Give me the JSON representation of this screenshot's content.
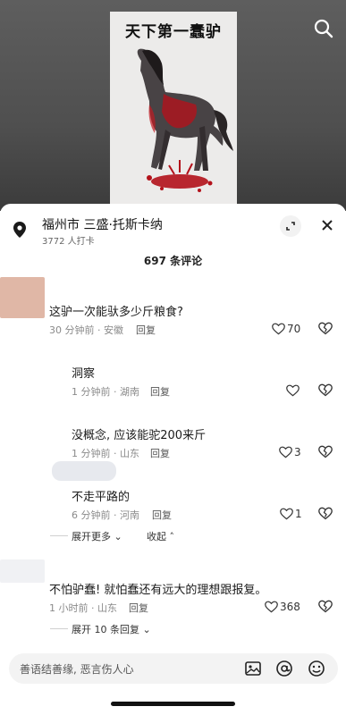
{
  "video": {
    "painting_title": "天下第一蠢驴"
  },
  "location": {
    "title": "福州市 三盛·托斯卡纳",
    "subtitle": "3772 人打卡"
  },
  "comments_header": {
    "count_label": "697 条评论"
  },
  "comments": [
    {
      "text": "这驴一次能驮多少斤粮食?",
      "time": "30 分钟前 · 安徽",
      "reply_label": "回复",
      "likes": "70"
    },
    {
      "text": "洞察",
      "time": "1 分钟前 · 湖南",
      "reply_label": "回复",
      "likes": ""
    },
    {
      "text": "没概念, 应该能驼200来斤",
      "time": "1 分钟前 · 山东",
      "reply_label": "回复",
      "likes": "3"
    },
    {
      "text": "不走平路的",
      "time": "6 分钟前 · 河南",
      "reply_label": "回复",
      "likes": "1"
    },
    {
      "text": "不怕驴蠢! 就怕蠢还有远大的理想跟报复。",
      "time": "1 小时前 · 山东",
      "reply_label": "回复",
      "likes": "368"
    }
  ],
  "thread_controls": {
    "expand_more": "展开更多",
    "collapse": "收起",
    "expand_replies": "展开 10 条回复"
  },
  "input": {
    "placeholder": "善语结善缘, 恶言伤人心"
  },
  "icons": {
    "search": "search-icon",
    "pin": "location-pin-icon",
    "expand": "expand-icon",
    "close": "close-icon",
    "like": "heart-icon",
    "dislike": "broken-heart-icon",
    "image": "image-icon",
    "mention": "at-icon",
    "emoji": "emoji-icon"
  },
  "colors": {
    "accent_text": "#1f1f1f",
    "meta_text": "#8a8a8a",
    "blood_red": "#b3121b"
  }
}
